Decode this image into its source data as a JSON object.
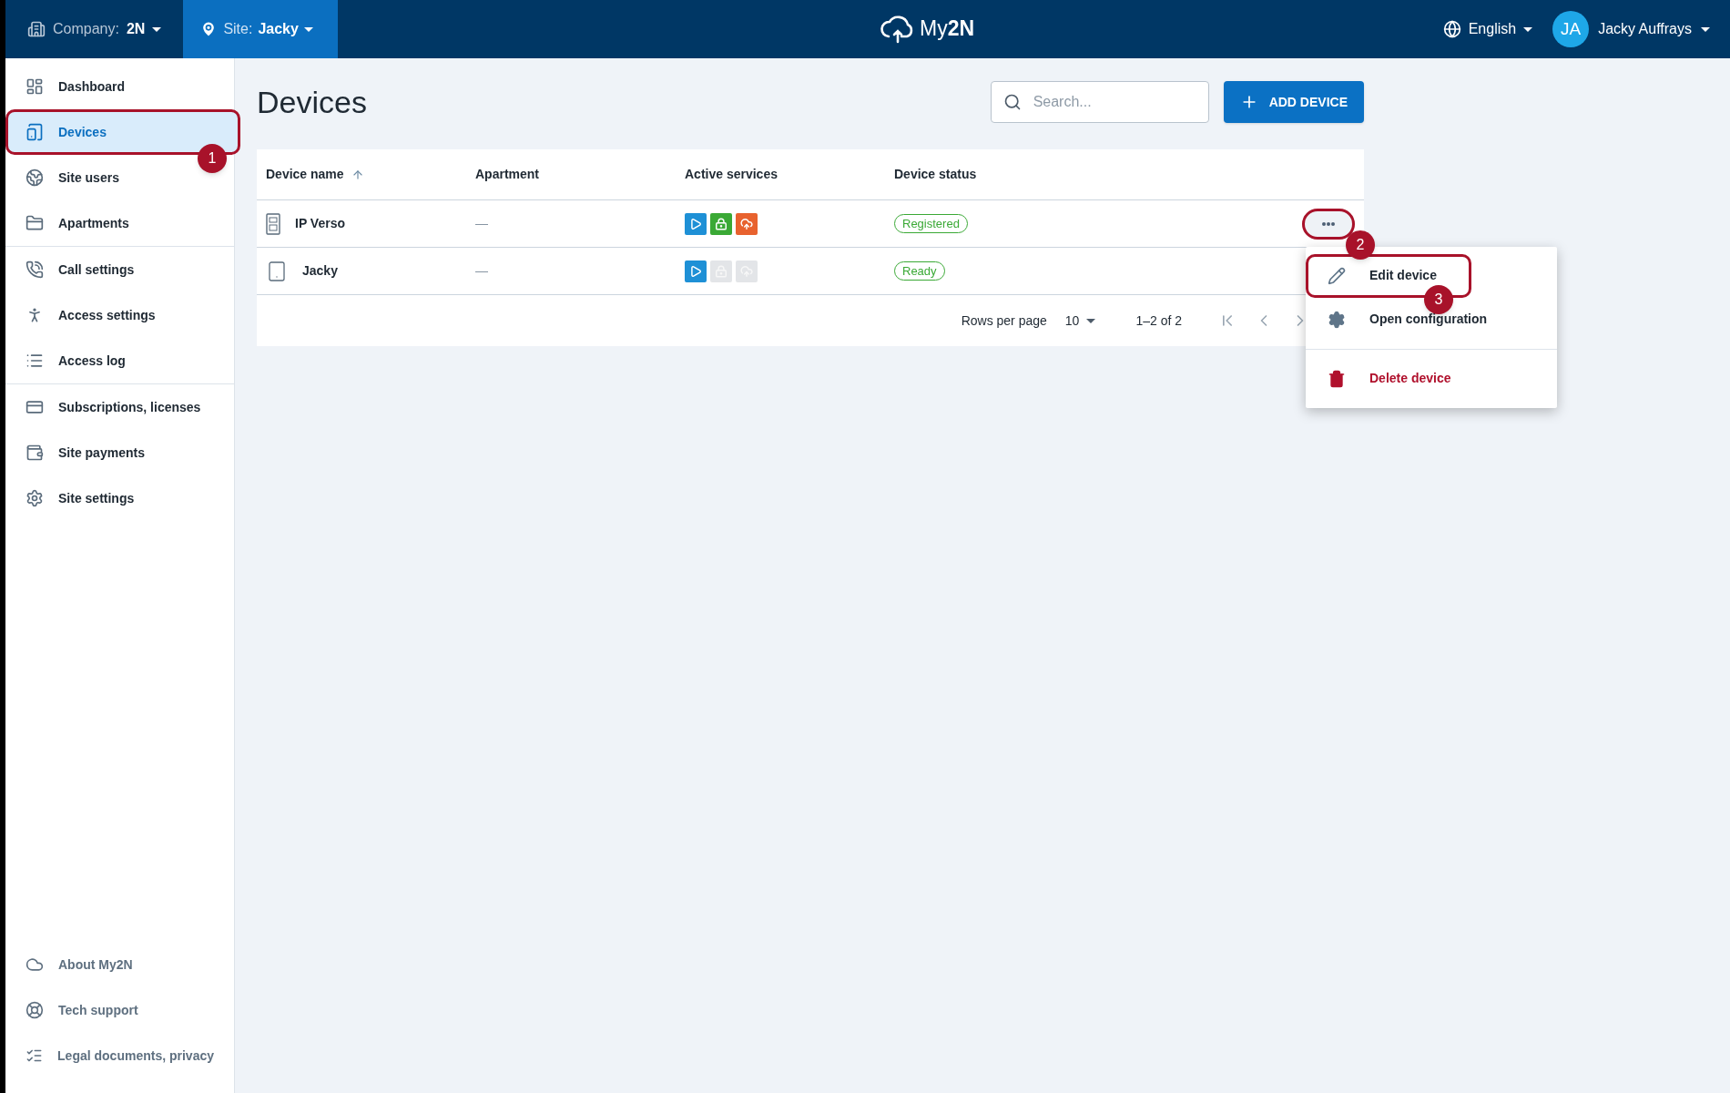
{
  "top_bar": {
    "company_label": "Company:",
    "company": "2N",
    "site_label": "Site:",
    "site": "Jacky",
    "logo_text": "My",
    "logo_bold": "2N",
    "language": "English",
    "avatar": "JA",
    "user": "Jacky Auffrays"
  },
  "sidebar": {
    "groups": [
      [
        {
          "label": "Dashboard",
          "selected": false
        },
        {
          "label": "Devices",
          "selected": true,
          "callout": "1"
        },
        {
          "label": "Site users",
          "selected": false
        },
        {
          "label": "Apartments",
          "selected": false
        }
      ],
      [
        {
          "label": "Call settings",
          "selected": false
        },
        {
          "label": "Access settings",
          "selected": false
        },
        {
          "label": "Access log",
          "selected": false
        }
      ],
      [
        {
          "label": "Subscriptions, licenses",
          "selected": false
        },
        {
          "label": "Site payments",
          "selected": false
        },
        {
          "label": "Site settings",
          "selected": false
        }
      ]
    ],
    "footer": [
      {
        "label": "About My2N"
      },
      {
        "label": "Tech support"
      },
      {
        "label": "Legal documents, privacy"
      }
    ]
  },
  "page": {
    "title": "Devices",
    "search": {
      "placeholder": "Search..."
    },
    "add_button": "ADD DEVICE"
  },
  "table": {
    "columns": [
      {
        "label": "Device name",
        "sorted": true
      },
      {
        "label": "Apartment",
        "sorted": false
      },
      {
        "label": "Active services",
        "sorted": false
      },
      {
        "label": "Device status",
        "sorted": false
      }
    ],
    "rows": [
      {
        "kind": "intercom",
        "name": "IP Verso",
        "apartment": "—",
        "services": [
          {
            "kind": "play",
            "active": true
          },
          {
            "kind": "lock",
            "active": true
          },
          {
            "kind": "cloud",
            "active": true
          }
        ],
        "status": "Registered",
        "menu_open": true,
        "callout": "2"
      },
      {
        "kind": "app",
        "name": "Jacky",
        "apartment": "—",
        "services": [
          {
            "kind": "play",
            "active": true
          },
          {
            "kind": "lock",
            "active": false
          },
          {
            "kind": "cloud",
            "active": false
          }
        ],
        "status": "Ready"
      }
    ],
    "pagination": {
      "rows_label": "Rows per page",
      "rows_value": "10",
      "range": "1–2 of 2"
    }
  },
  "menu": {
    "items": [
      {
        "kind": "edit",
        "label": "Edit device",
        "callout": "3"
      },
      {
        "kind": "config",
        "label": "Open configuration"
      },
      {
        "kind": "delete",
        "label": "Delete device"
      }
    ]
  }
}
